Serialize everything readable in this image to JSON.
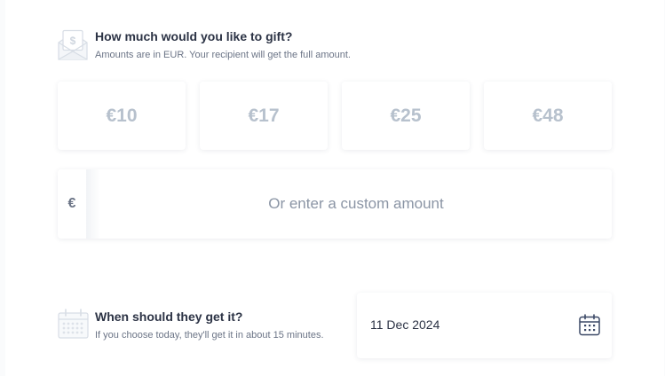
{
  "amount_section": {
    "icon": "money-envelope-icon",
    "title": "How much would you like to gift?",
    "subtitle": "Amounts are in EUR. Your recipient will get the full amount.",
    "options": [
      "€10",
      "€17",
      "€25",
      "€48"
    ],
    "custom": {
      "currency_symbol": "€",
      "placeholder": "Or enter a custom amount",
      "value": ""
    }
  },
  "delivery_section": {
    "icon": "calendar-icon",
    "title": "When should they get it?",
    "subtitle": "If you choose today, they'll get it in about 15 minutes.",
    "date_value": "11 Dec 2024",
    "picker_icon": "calendar-icon"
  },
  "colors": {
    "text": "#2c3345",
    "muted": "#6b7486",
    "amount_text": "#b7c1cd",
    "icon_stroke": "#d7dde5",
    "accent_icon": "#3b4866"
  }
}
